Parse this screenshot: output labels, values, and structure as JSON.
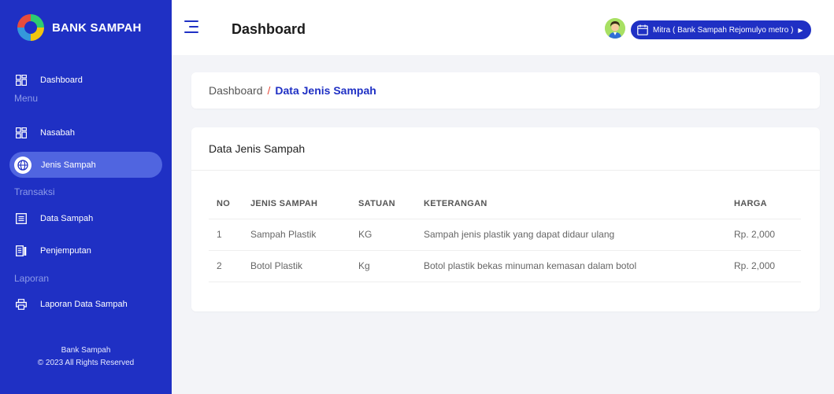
{
  "sidebar": {
    "brand": "BANK SAMPAH",
    "items": [
      {
        "label": "Dashboard",
        "icon": "dashboard-icon"
      },
      {
        "label": "Nasabah",
        "icon": "dashboard-icon"
      },
      {
        "label": "Jenis Sampah",
        "icon": "globe-icon",
        "active": true
      },
      {
        "label": "Data Sampah",
        "icon": "list-icon"
      },
      {
        "label": "Penjemputan",
        "icon": "document-icon"
      },
      {
        "label": "Laporan Data Sampah",
        "icon": "printer-icon"
      }
    ],
    "sections": [
      "Menu",
      "Transaksi",
      "Laporan"
    ],
    "footer": {
      "line1": "Bank Sampah",
      "line2": "© 2023 All Rights Reserved"
    }
  },
  "topbar": {
    "title": "Dashboard",
    "user_label": "Mitra ( Bank Sampah Rejomulyo metro )"
  },
  "breadcrumb": {
    "root": "Dashboard",
    "separator": "/",
    "current": "Data Jenis Sampah"
  },
  "table_card": {
    "title": "Data Jenis Sampah",
    "headers": [
      "NO",
      "JENIS SAMPAH",
      "SATUAN",
      "KETERANGAN",
      "HARGA"
    ],
    "rows": [
      [
        "1",
        "Sampah Plastik",
        "KG",
        "Sampah jenis plastik yang dapat didaur ulang",
        "Rp. 2,000"
      ],
      [
        "2",
        "Botol Plastik",
        "Kg",
        "Botol plastik bekas minuman kemasan dalam botol",
        "Rp. 2,000"
      ]
    ]
  },
  "colors": {
    "primary": "#1f30c4",
    "active_item": "#5065e0",
    "breadcrumb_sep": "#e74c3c",
    "background": "#f3f4f8"
  }
}
